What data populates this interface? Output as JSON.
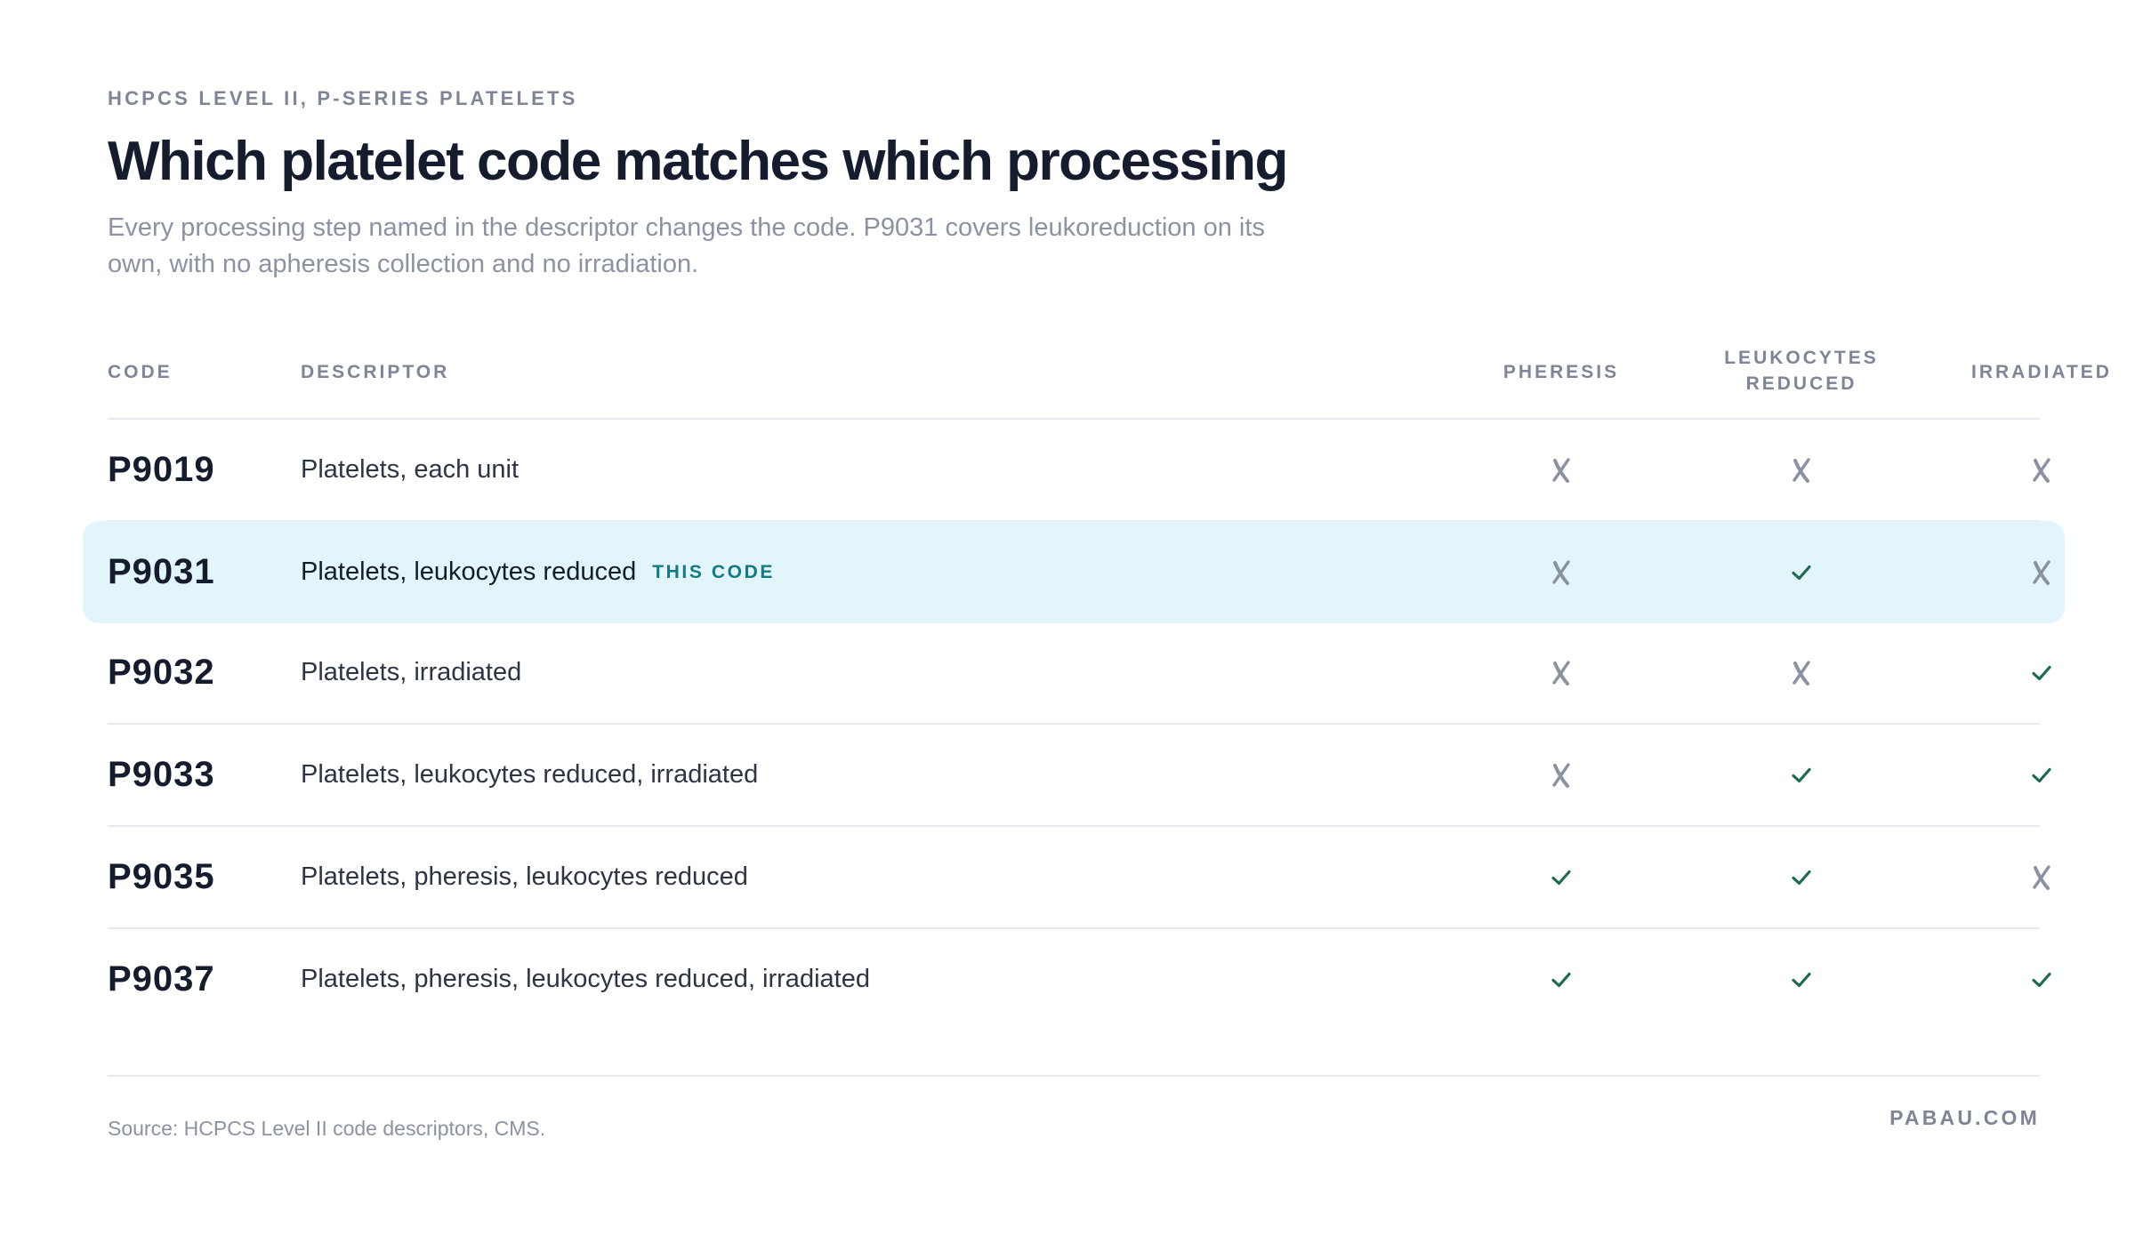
{
  "header": {
    "eyebrow": "HCPCS LEVEL II, P-SERIES PLATELETS",
    "title": "Which platelet code matches which processing",
    "subtitle": "Every processing step named in the descriptor changes the code. P9031 covers leukoreduction on its own, with no apheresis collection and no irradiation."
  },
  "table": {
    "columns": {
      "code": "CODE",
      "descriptor": "DESCRIPTOR",
      "pheresis": "PHERESIS",
      "leukocytes_line1": "LEUKOCYTES",
      "leukocytes_line2": "REDUCED",
      "irradiated": "IRRADIATED"
    },
    "rows": [
      {
        "code": "P9019",
        "descriptor": "Platelets, each unit",
        "pheresis": false,
        "leukocytes_reduced": false,
        "irradiated": false
      },
      {
        "code": "P9031",
        "descriptor": "Platelets, leukocytes reduced",
        "badge": "THIS CODE",
        "highlight": true,
        "pheresis": false,
        "leukocytes_reduced": true,
        "irradiated": false
      },
      {
        "code": "P9032",
        "descriptor": "Platelets, irradiated",
        "pheresis": false,
        "leukocytes_reduced": false,
        "irradiated": true
      },
      {
        "code": "P9033",
        "descriptor": "Platelets, leukocytes reduced, irradiated",
        "pheresis": false,
        "leukocytes_reduced": true,
        "irradiated": true
      },
      {
        "code": "P9035",
        "descriptor": "Platelets, pheresis, leukocytes reduced",
        "pheresis": true,
        "leukocytes_reduced": true,
        "irradiated": false
      },
      {
        "code": "P9037",
        "descriptor": "Platelets, pheresis, leukocytes reduced, irradiated",
        "pheresis": true,
        "leukocytes_reduced": true,
        "irradiated": true
      }
    ]
  },
  "icons": {
    "yes": "check-icon",
    "no": "cross-icon"
  },
  "colors": {
    "check": "#1d6b4e",
    "cross": "#8a92a0",
    "highlight_bg": "#e2f5fa",
    "badge": "#127a84"
  },
  "footer": {
    "source": "Source: HCPCS Level II code descriptors, CMS.",
    "brand": "PABAU.COM"
  }
}
